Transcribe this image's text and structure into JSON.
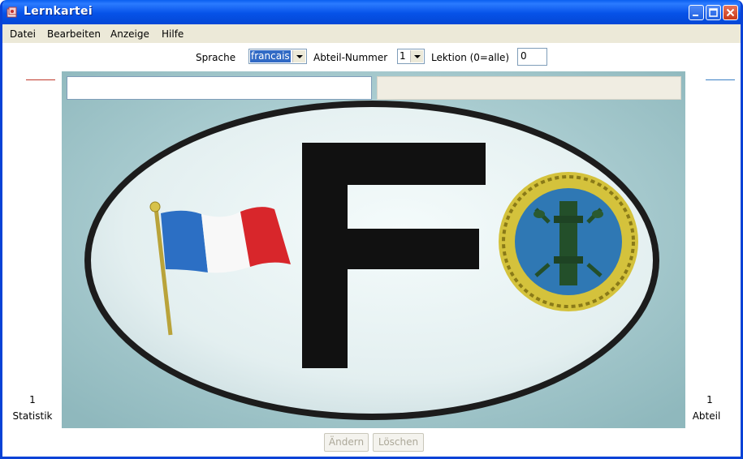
{
  "window": {
    "title": "Lernkartei"
  },
  "menu": [
    "Datei",
    "Bearbeiten",
    "Anzeige",
    "Hilfe"
  ],
  "toolbar": {
    "sprache_label": "Sprache",
    "sprache_value": "francais",
    "abteil_label": "Abteil-Nummer",
    "abteil_value": "1",
    "lektion_label": "Lektion (0=alle)",
    "lektion_value": "0"
  },
  "fields": {
    "question": "",
    "answer": ""
  },
  "image": {
    "letter": "F",
    "description_icons": [
      "french-flag-icon",
      "seal-icon"
    ]
  },
  "left_panel": {
    "count": "1",
    "label": "Statistik"
  },
  "right_panel": {
    "count": "1",
    "label": "Abteil"
  },
  "buttons": {
    "change": "Ändern",
    "delete": "Löschen"
  },
  "colors": {
    "titlebar": "#0652e8",
    "chrome": "#ece9d8",
    "flag_blue": "#2c6fc4",
    "flag_red": "#d8262b"
  }
}
